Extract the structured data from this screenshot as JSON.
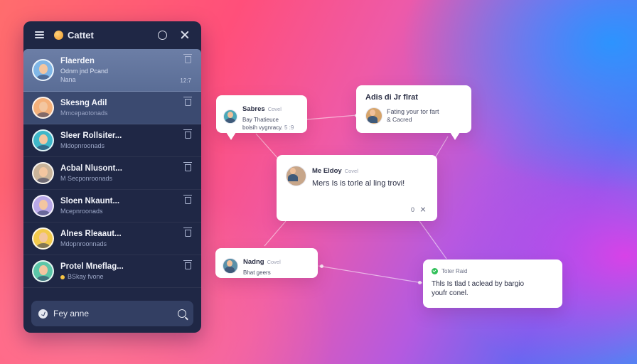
{
  "app": {
    "title": "Cattet"
  },
  "chat_list": [
    {
      "name": "Flaerden",
      "preview": "Odnm jnd Pcand",
      "preview2": "Nana",
      "time": "12:7"
    },
    {
      "name": "Skesng Adil",
      "preview": "Mmcepaotonads",
      "time": ""
    },
    {
      "name": "Sleer Rollsiter...",
      "preview": "Mldopnroonads",
      "time": ""
    },
    {
      "name": "Acbal Nlusont...",
      "preview": "M Secponroonads",
      "time": ""
    },
    {
      "name": "Sloen Nkaunt...",
      "preview": "Mcepnroonads",
      "time": ""
    },
    {
      "name": "Alnes Rleaaut...",
      "preview": "Mdopnroonnads",
      "time": ""
    },
    {
      "name": "Protel Mneflag...",
      "preview": "BSkay fvone",
      "time": ""
    }
  ],
  "search": {
    "placeholder": "Fey anne"
  },
  "cards": {
    "a": {
      "name": "Sabres",
      "sub": "Covel",
      "line1": "Bay Thatieuce",
      "line2": "boisih vygnracy.",
      "time": "5 :9"
    },
    "b": {
      "title": "Adis di Jr flrat",
      "line1": "Fating your tor fart",
      "line2": "& Cacred"
    },
    "c": {
      "name": "Me Eldoy",
      "sub": "Covel",
      "message": "Mers Is is torle al ling trovi!",
      "count": "0"
    },
    "d": {
      "name": "Nadng",
      "sub": "Covel",
      "line1": "Bhat geers"
    },
    "e": {
      "title": "Toter Raid",
      "line1": "Thls Is tlad t aclead by bargio",
      "line2": "youfr conel."
    }
  }
}
